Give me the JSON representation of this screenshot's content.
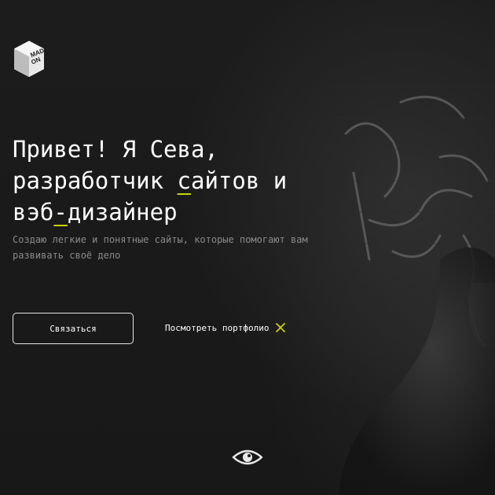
{
  "logo": {
    "text_line1": "MADE",
    "text_line2": "ON",
    "icon": "made-on-logo-icon"
  },
  "hero": {
    "headline_line1": "Привет! Я Сева,",
    "headline_line2_part1": "разработчик ",
    "headline_line2_accent": "с",
    "headline_line2_part2": "айтов и",
    "headline_line3_part1": "вэб",
    "headline_line3_accent": "-",
    "headline_line3_part2": "дизайнер",
    "subtitle": "Создаю легкие и понятные сайты, которые помогают вам развивать своё дело"
  },
  "actions": {
    "contact_label": "Связаться",
    "portfolio_label": "Посмотреть портфолио",
    "portfolio_icon": "cross-icon"
  },
  "footer": {
    "view_icon": "eye-icon"
  },
  "colors": {
    "background": "#1b1b1b",
    "text": "#ffffff",
    "muted_text": "#8a8a8a",
    "accent": "#c8d400"
  }
}
